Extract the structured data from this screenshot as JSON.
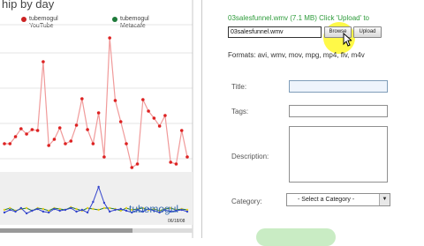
{
  "chart_panel": {
    "title": "hip by day",
    "legend": [
      {
        "name": "tubemogul YouTube",
        "line1": "tubemogul",
        "line2": "YouTube",
        "color": "#cc2222"
      },
      {
        "name": "tubemogul Metacafe",
        "line1": "tubemogul",
        "line2": "Metacafe",
        "color": "#1e7a3a"
      }
    ],
    "watermark": "tubemogul",
    "date_label": "06/18/08"
  },
  "chart_data": {
    "type": "line",
    "title": "hip by day",
    "series": [
      {
        "name": "tubemogul YouTube",
        "color": "#dd3333",
        "values": [
          163,
          163,
          155,
          146,
          152,
          147,
          148,
          70,
          165,
          158,
          145,
          163,
          160,
          142,
          112,
          147,
          163,
          128,
          178,
          43,
          114,
          138,
          163,
          190,
          186,
          113,
          126,
          134,
          143,
          131,
          184,
          186,
          148,
          178
        ]
      },
      {
        "name": "tubemogul Metacafe",
        "color": "#1e7a3a",
        "values": [
          238,
          236,
          239,
          237,
          236,
          239,
          236,
          237,
          239,
          236,
          237,
          238,
          235,
          237,
          239,
          236,
          237,
          238,
          236,
          236,
          237,
          239,
          236,
          238,
          237,
          236,
          238,
          237,
          239,
          237,
          236,
          238,
          237,
          238
        ]
      },
      {
        "name": "",
        "color": "#3344cc",
        "values": [
          241,
          238,
          240,
          236,
          242,
          239,
          237,
          240,
          241,
          237,
          239,
          238,
          236,
          240,
          238,
          241,
          229,
          212,
          230,
          240,
          238,
          237,
          239,
          241,
          238,
          240,
          237,
          239,
          241,
          238,
          240,
          239,
          238,
          240
        ]
      }
    ]
  },
  "upload": {
    "file_status": "03salesfunnel.wmv (7.1 MB) Click 'Upload' to",
    "file_value": "03salesfunnel.wmv",
    "browse_label": "Browse",
    "upload_label": "Upload",
    "formats": "Formats: avi, wmv, mov, mpg, mp4, flv, m4v"
  },
  "form": {
    "title_label": "Title:",
    "tags_label": "Tags:",
    "description_label": "Description:",
    "category_label": "Category:",
    "category_selected": "- Select a Category -"
  },
  "colors": {
    "status_green": "#2d9b3a",
    "highlight_yellow": "#fff828",
    "series_red": "#dd3333"
  },
  "icons": [
    "mouse-cursor-icon",
    "dropdown-arrow-icon"
  ]
}
